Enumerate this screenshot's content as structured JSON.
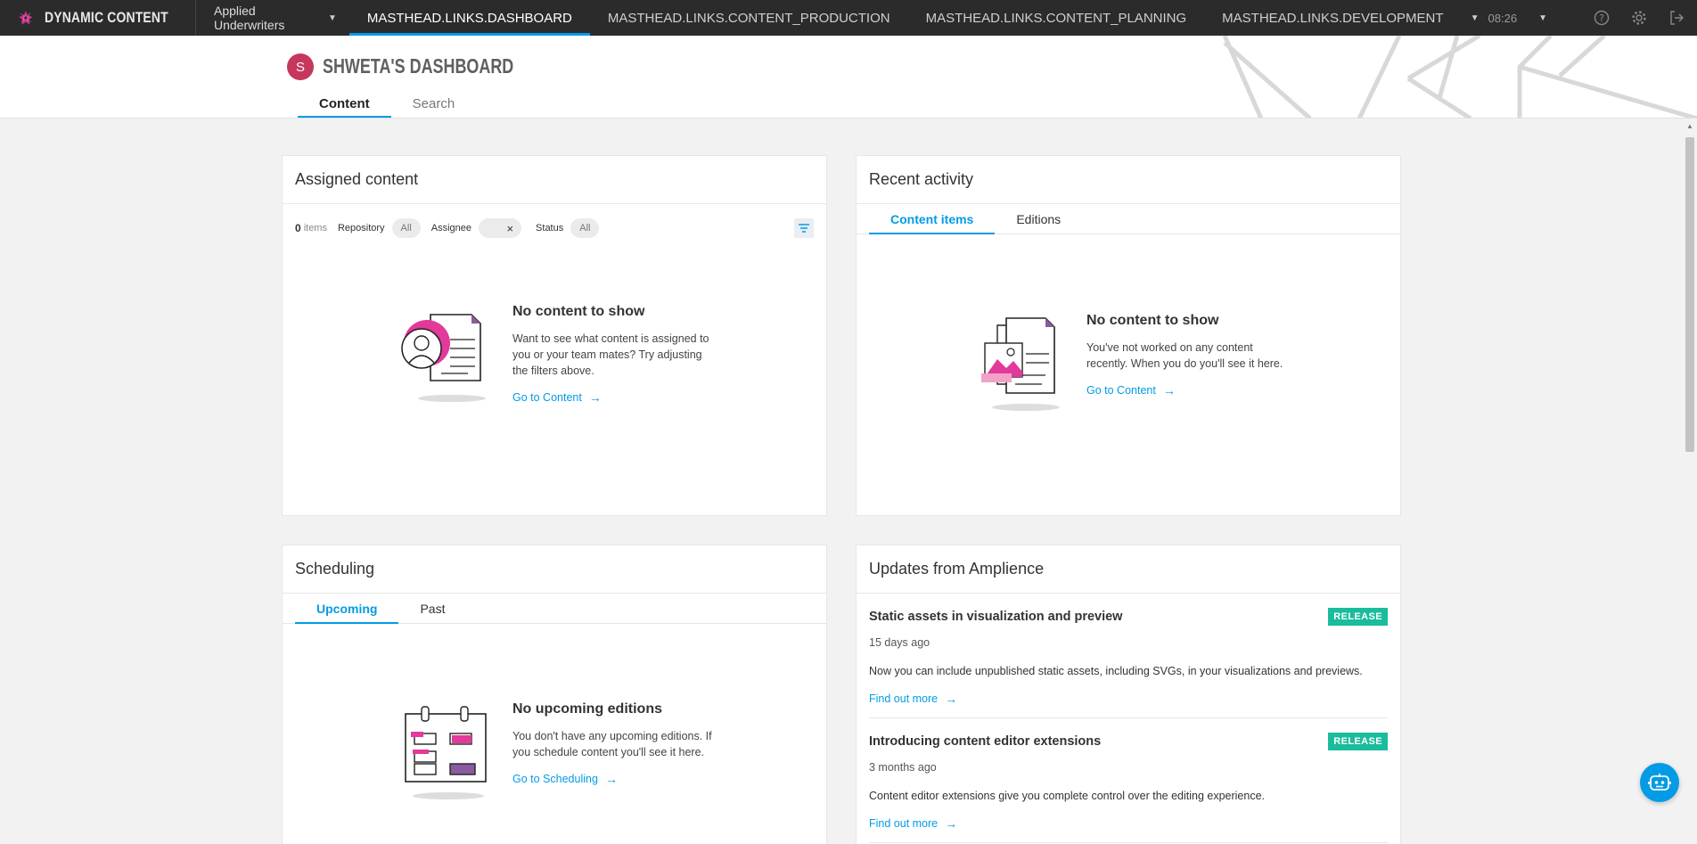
{
  "masthead": {
    "product_name": "DYNAMIC CONTENT",
    "hub_name": "Applied Underwriters",
    "links": [
      {
        "label": "MASTHEAD.LINKS.DASHBOARD",
        "active": true
      },
      {
        "label": "MASTHEAD.LINKS.CONTENT_PRODUCTION",
        "active": false
      },
      {
        "label": "MASTHEAD.LINKS.CONTENT_PLANNING",
        "active": false
      },
      {
        "label": "MASTHEAD.LINKS.DEVELOPMENT",
        "active": false
      }
    ],
    "time": "08:26",
    "icons": [
      "help-icon",
      "gear-icon",
      "logout-icon"
    ]
  },
  "dashboard": {
    "avatar_initial": "S",
    "title": "SHWETA'S DASHBOARD",
    "tabs": [
      {
        "label": "Content",
        "active": true
      },
      {
        "label": "Search",
        "active": false
      }
    ]
  },
  "assigned": {
    "title": "Assigned content",
    "count": "0",
    "items_label": "items",
    "repository_label": "Repository",
    "repository_value": "All",
    "assignee_label": "Assignee",
    "assignee_clear": "×",
    "status_label": "Status",
    "status_value": "All",
    "empty_title": "No content to show",
    "empty_text": "Want to see what content is assigned to you or your team mates? Try adjusting the filters above.",
    "link": "Go to Content"
  },
  "recent": {
    "title": "Recent activity",
    "tabs": [
      {
        "label": "Content items",
        "active": true
      },
      {
        "label": "Editions",
        "active": false
      }
    ],
    "empty_title": "No content to show",
    "empty_text": "You've not worked on any content recently. When you do you'll see it here.",
    "link": "Go to Content"
  },
  "scheduling": {
    "title": "Scheduling",
    "tabs": [
      {
        "label": "Upcoming",
        "active": true
      },
      {
        "label": "Past",
        "active": false
      }
    ],
    "empty_title": "No upcoming editions",
    "empty_text": "You don't have any upcoming editions. If you schedule content you'll see it here.",
    "link": "Go to Scheduling"
  },
  "updates": {
    "title": "Updates from Amplience",
    "items": [
      {
        "title": "Static assets in visualization and preview",
        "badge": "RELEASE",
        "date": "15 days ago",
        "body": "Now you can include unpublished static assets, including SVGs, in your visualizations and previews.",
        "link": "Find out more"
      },
      {
        "title": "Introducing content editor extensions",
        "badge": "RELEASE",
        "date": "3 months ago",
        "body": "Content editor extensions give you complete control over the editing experience.",
        "link": "Find out more"
      }
    ]
  },
  "colors": {
    "accent": "#039be5",
    "masthead_bg": "#2b2b2b",
    "avatar": "#c5375c",
    "badge": "#1abc9c",
    "illustration_pink": "#e2399a"
  }
}
